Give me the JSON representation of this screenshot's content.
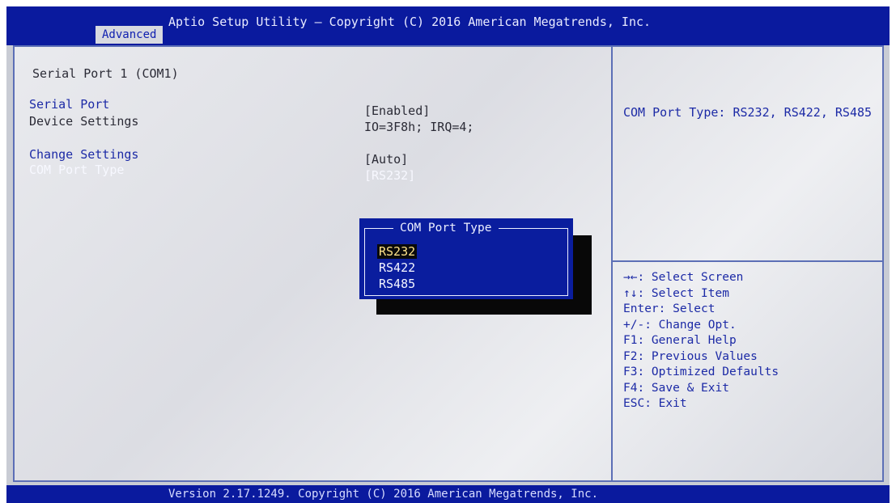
{
  "header": {
    "title": "Aptio Setup Utility – Copyright (C) 2016 American Megatrends, Inc.",
    "active_tab": "Advanced"
  },
  "main": {
    "section_title": "Serial Port 1 (COM1)",
    "rows": [
      {
        "label": "Serial Port",
        "value": "[Enabled]"
      },
      {
        "label": "Device Settings",
        "value": "IO=3F8h; IRQ=4;"
      },
      {
        "label": "Change Settings",
        "value": "[Auto]"
      },
      {
        "label": "COM Port Type",
        "value": "[RS232]"
      }
    ]
  },
  "help": {
    "text": "COM Port Type: RS232, RS422, RS485"
  },
  "keys": [
    "→←: Select Screen",
    "↑↓: Select Item",
    "Enter: Select",
    "+/-: Change Opt.",
    "F1: General Help",
    "F2: Previous Values",
    "F3: Optimized Defaults",
    "F4: Save & Exit",
    "ESC: Exit"
  ],
  "popup": {
    "title": "COM Port Type",
    "options": [
      "RS232",
      "RS422",
      "RS485"
    ],
    "selected": "RS232"
  },
  "footer": {
    "text": "Version 2.17.1249. Copyright (C) 2016 American Megatrends, Inc."
  },
  "colors": {
    "bar_blue": "#0a1a9e",
    "text_blue": "#1c2aa6",
    "highlight": "#ffffff"
  }
}
